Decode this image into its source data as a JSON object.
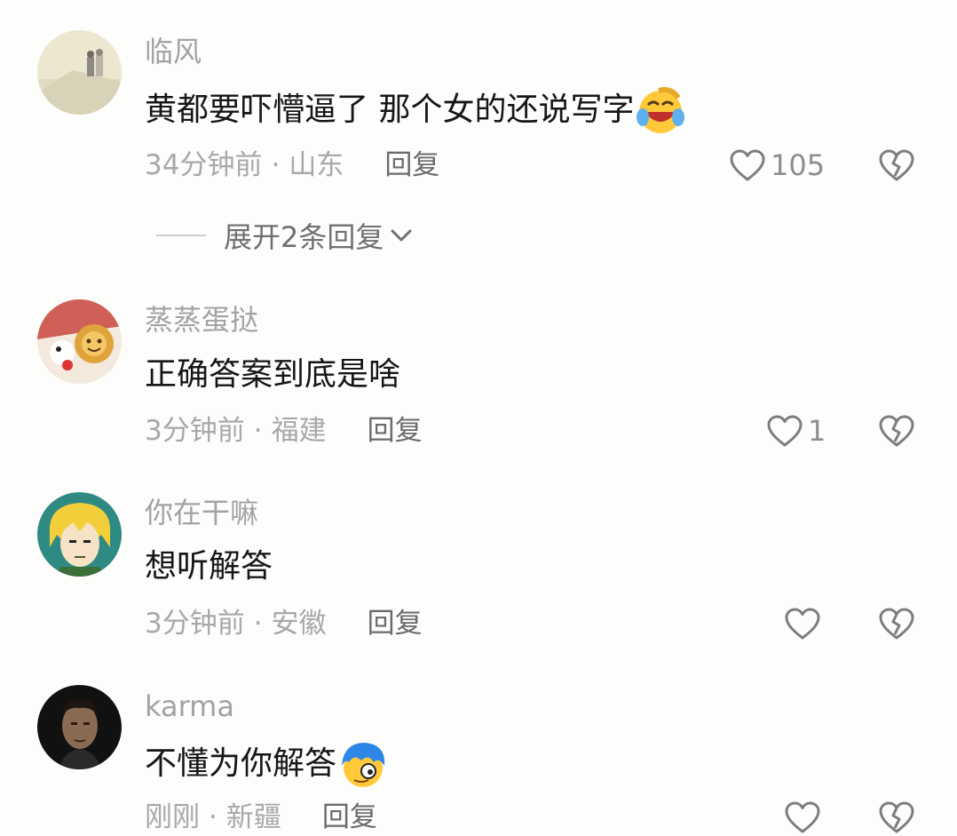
{
  "comments": [
    {
      "username": "临风",
      "text": "黄都要吓懵逼了 那个女的还说写字",
      "emoji": "laughing-crying-emoji",
      "time": "34分钟前",
      "separator": "·",
      "location": "山东",
      "reply_label": "回复",
      "like_count": "105",
      "expand_label": "展开2条回复"
    },
    {
      "username": "蒸蒸蛋挞",
      "text": "正确答案到底是啥",
      "time": "3分钟前",
      "separator": "·",
      "location": "福建",
      "reply_label": "回复",
      "like_count": "1"
    },
    {
      "username": "你在干嘛",
      "text": "想听解答",
      "time": "3分钟前",
      "separator": "·",
      "location": "安徽",
      "reply_label": "回复",
      "like_count": ""
    },
    {
      "username": "karma",
      "text": "不懂为你解答",
      "emoji": "blue-hair-emoji",
      "time": "刚刚",
      "separator": "·",
      "location": "新疆",
      "reply_label": "回复",
      "like_count": ""
    }
  ],
  "icons": {
    "like": "heart-outline-icon",
    "dislike": "broken-heart-icon",
    "expand": "chevron-down-icon"
  },
  "colors": {
    "background": "#fdfdfb",
    "text": "#161616",
    "muted": "#a3a3a3"
  }
}
